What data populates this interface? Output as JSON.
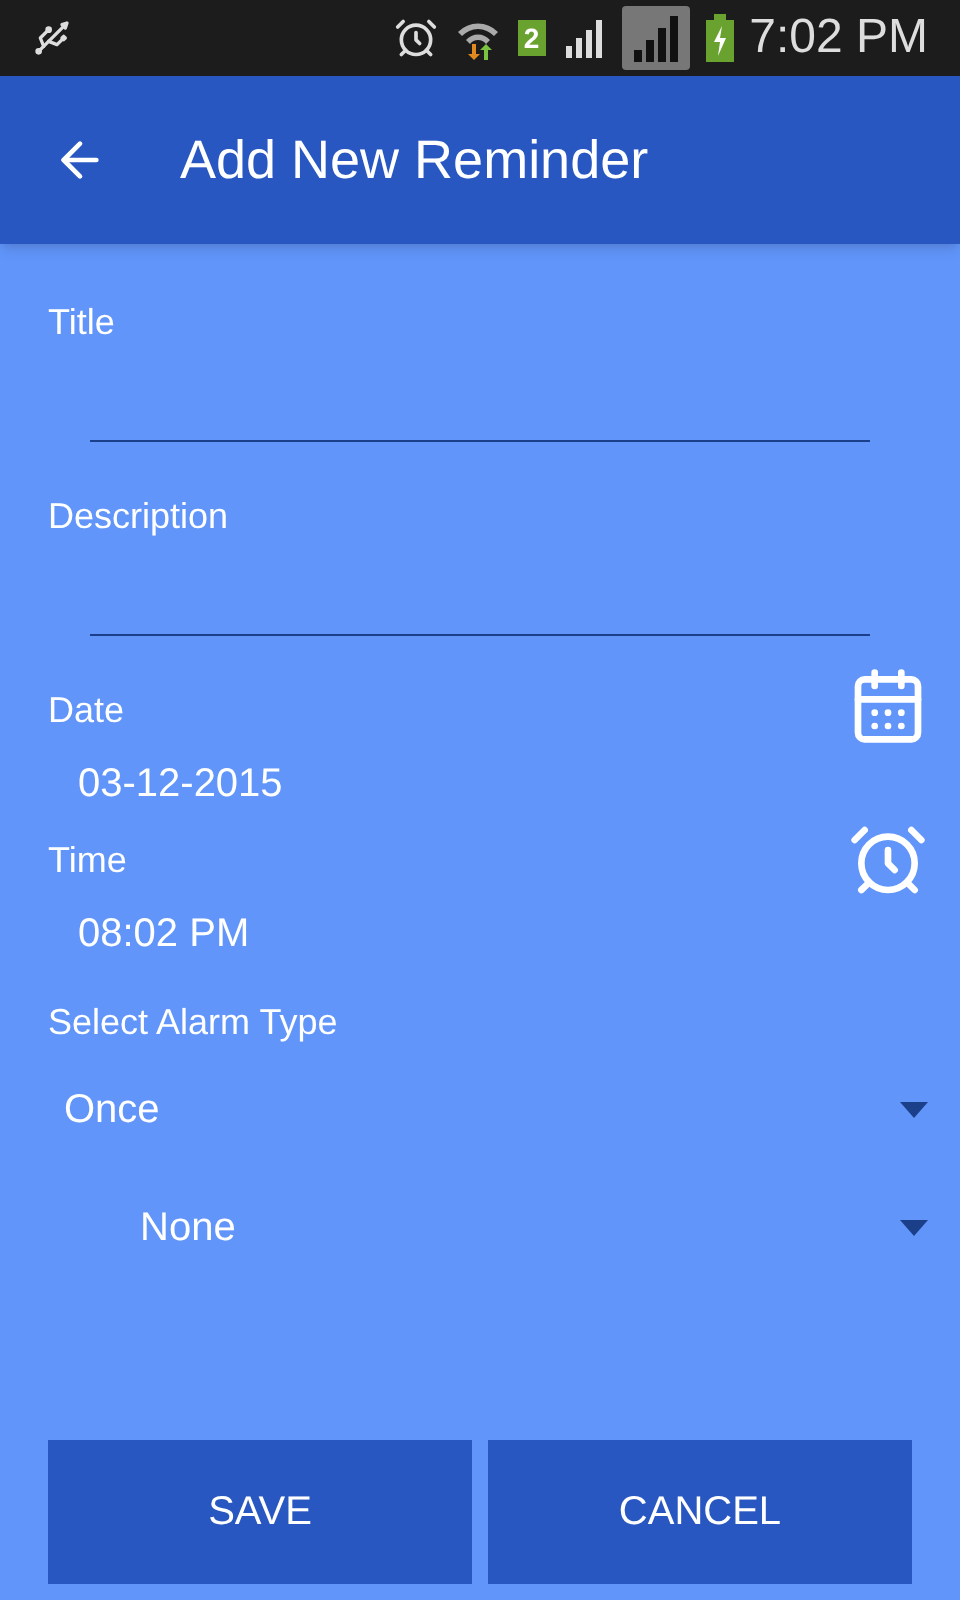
{
  "status_bar": {
    "sim_badge": "2",
    "time": "7:02 PM"
  },
  "app_bar": {
    "title": "Add New Reminder"
  },
  "fields": [
    {
      "label": "Title"
    },
    {
      "label": "Description"
    }
  ],
  "date": {
    "label": "Date",
    "value": "03-12-2015"
  },
  "time": {
    "label": "Time",
    "value": "08:02 PM"
  },
  "alarm": {
    "label": "Select Alarm Type",
    "dropdowns": [
      {
        "value": "Once"
      },
      {
        "value": "None"
      }
    ]
  },
  "buttons": [
    {
      "label": "SAVE"
    },
    {
      "label": "CANCEL"
    }
  ]
}
